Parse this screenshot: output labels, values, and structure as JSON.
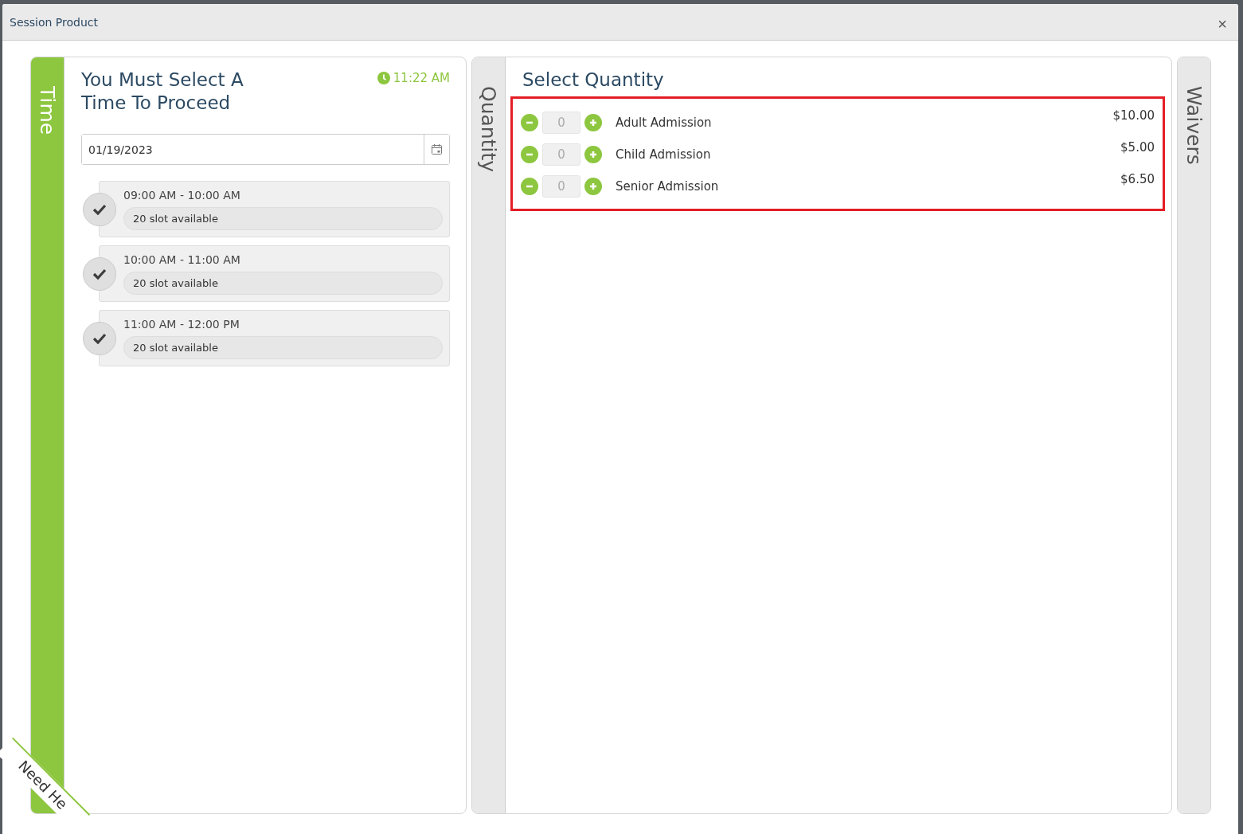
{
  "window": {
    "title": "Session Product",
    "close": "×"
  },
  "time_panel": {
    "tab": "Time",
    "heading": "You Must Select A\nTime To Proceed",
    "clock": "11:22 AM",
    "date": "01/19/2023",
    "slots": [
      {
        "time": "09:00 AM - 10:00 AM",
        "availability": "20 slot available"
      },
      {
        "time": "10:00 AM - 11:00 AM",
        "availability": "20 slot available"
      },
      {
        "time": "11:00 AM - 12:00 PM",
        "availability": "20 slot available"
      }
    ]
  },
  "quantity_panel": {
    "tab": "Quantity",
    "heading": "Select Quantity",
    "items": [
      {
        "name": "Adult Admission",
        "quantity": "0",
        "price": "$10.00"
      },
      {
        "name": "Child Admission",
        "quantity": "0",
        "price": "$5.00"
      },
      {
        "name": "Senior Admission",
        "quantity": "0",
        "price": "$6.50"
      }
    ]
  },
  "waivers_tab": "Waivers",
  "help_ribbon": "Need He"
}
